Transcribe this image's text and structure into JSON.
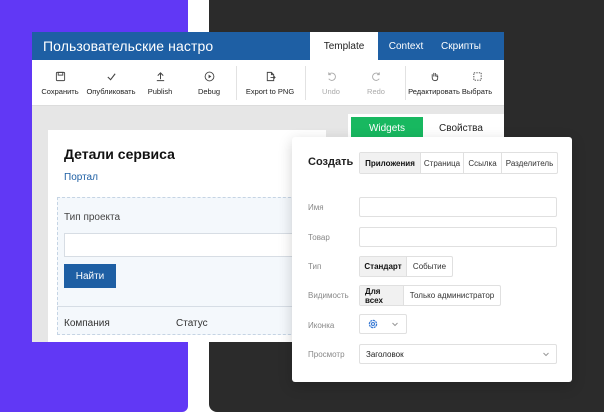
{
  "app": {
    "title": "Пользовательские настро",
    "tabs": [
      "Template",
      "Context",
      "Скрипты"
    ]
  },
  "toolbar": {
    "items": [
      {
        "label": "Сохранить",
        "icon": "save-icon",
        "enabled": true
      },
      {
        "label": "Опубликовать",
        "icon": "check-icon",
        "enabled": true
      },
      {
        "label": "Publish",
        "icon": "upload-icon",
        "enabled": true
      },
      {
        "label": "Debug",
        "icon": "play-icon",
        "enabled": true
      },
      {
        "label": "Export to PNG",
        "icon": "export-icon",
        "enabled": true
      },
      {
        "label": "Undo",
        "icon": "undo-icon",
        "enabled": false
      },
      {
        "label": "Redo",
        "icon": "redo-icon",
        "enabled": false
      },
      {
        "label": "Редактировать",
        "icon": "hand-icon",
        "enabled": true
      },
      {
        "label": "Выбрать",
        "icon": "select-icon",
        "enabled": true
      }
    ]
  },
  "canvas": {
    "title": "Детали сервиса",
    "link": "Портал",
    "field_label": "Тип проекта",
    "find_button": "Найти",
    "columns": [
      "Компания",
      "Статус"
    ]
  },
  "widget_tabs": [
    "Widgets",
    "Свойства"
  ],
  "panel": {
    "title": "Создать",
    "create_tabs": [
      "Приложения",
      "Страница",
      "Ссылка",
      "Разделитель"
    ],
    "name_label": "Имя",
    "product_label": "Товар",
    "type_label": "Тип",
    "type_options": [
      "Стандарт",
      "Событие"
    ],
    "visibility_label": "Видимость",
    "visibility_options": [
      "Для всех",
      "Только администратор"
    ],
    "icon_label": "Иконка",
    "view_label": "Просмотр",
    "view_value": "Заголовок"
  },
  "colors": {
    "brand_blue": "#1e5fa4",
    "accent_green": "#18b860",
    "background_purple": "#6138f5",
    "background_dark": "#2b2b2b",
    "icon_blue": "#3a7bd5"
  }
}
